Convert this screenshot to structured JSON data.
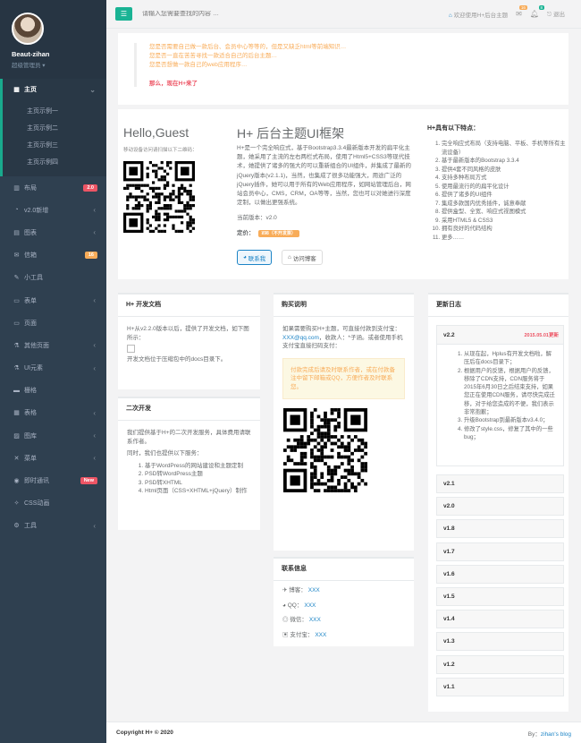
{
  "sidebar": {
    "user": "Beaut-zihan",
    "role": "超级管理员",
    "menu": [
      {
        "icon": "home",
        "label": "主页",
        "active": true
      },
      {
        "icon": "layout",
        "label": "布局",
        "badge": "2.0",
        "badge_color": "#ed5565"
      },
      {
        "icon": "pie",
        "label": "v2.0新增"
      },
      {
        "icon": "chart",
        "label": "图表"
      },
      {
        "icon": "mail",
        "label": "信箱",
        "badge": "16",
        "badge_color": "#f8ac59"
      },
      {
        "icon": "edit",
        "label": "小工具"
      },
      {
        "icon": "form",
        "label": "表单"
      },
      {
        "icon": "desktop",
        "label": "页面"
      },
      {
        "icon": "flask",
        "label": "其他页面"
      },
      {
        "icon": "flask",
        "label": "UI元素"
      },
      {
        "icon": "laptop",
        "label": "栅格"
      },
      {
        "icon": "table",
        "label": "表格"
      },
      {
        "icon": "picture",
        "label": "图库"
      },
      {
        "icon": "cutlery",
        "label": "菜单"
      },
      {
        "icon": "comments",
        "label": "即时通讯",
        "badge": "New",
        "badge_color": "#ed5565"
      },
      {
        "icon": "magic",
        "label": "CSS动画"
      },
      {
        "icon": "tools",
        "label": "工具"
      }
    ],
    "submenu": [
      "主页示例一",
      "主页示例二",
      "主页示例三",
      "主页示例四"
    ]
  },
  "topbar": {
    "search_placeholder": "请输入您需要查找的内容 …",
    "welcome": "欢迎使用H+后台主题",
    "mail_count": "16",
    "bell_count": "8",
    "logout": "退出"
  },
  "notice": {
    "lines": [
      "您是否需要自己做一款后台、会员中心等等的，但是又缺乏html等前端知识…",
      "您是否一直在苦苦寻找一款适合自己的后台主题…",
      "您是否想做一款自己的web应用程序…"
    ],
    "emph": "那么，现在H+来了"
  },
  "intro": {
    "hello": "Hello,Guest",
    "scan": "移动设备访问请扫描以下二维码：",
    "title": "H+ 后台主题UI框架",
    "desc": "H+是一个完全响应式，基于Bootstrap3.3.4最新版本开发的扁平化主题，她采用了主流的左右两栏式布局，使用了Html5+CSS3等现代技术，她提供了诸多的强大的可以重新组合的UI组件，并集成了最新的jQuery版本(v2.1.1)，当然，也集成了很多功能强大，用途广泛的jQuery插件，她可以用于所有的Web应用程序，如网站管理后台，网站会员中心，CMS，CRM，OA等等，当然，您也可以对她进行深度定制，以做出更强系统。",
    "version": "当前版本：v2.0",
    "price_label": "定价：",
    "price_tag": "¥98（不开发票）",
    "btn_contact": "联系我",
    "btn_visit": "访问博客"
  },
  "features": {
    "title": "H+具有以下特点：",
    "items": [
      "完全响应式布局（支持电脑、平板、手机等所有主流设备）",
      "基于最新版本的Bootstrap 3.3.4",
      "提供4套不同风格的皮肤",
      "支持多种布局方式",
      "使用最流行的的扁平化设计",
      "提供了诸多的UI组件",
      "集成多款国内优秀插件，诚意奉献",
      "提供盒型、全宽、响应式视图模式",
      "采用HTML5 & CSS3",
      "拥有良好的代码结构",
      "更多……"
    ]
  },
  "docs": {
    "title": "H+ 开发文档",
    "text": "H+从v2.2.0版本以后，提供了开发文档，如下图所示：",
    "text2": "开发文档位于压缩包中的docs目录下。"
  },
  "dev2": {
    "title": "二次开发",
    "p1": "我们提供基于H+的二次开发服务，具体费用请联系作者。",
    "p2": "同时，我们也提供以下服务：",
    "items": [
      "基于WordPress的网站建设和主题定制",
      "PSD转WordPress主题",
      "PSD转XHTML",
      "Html页面（CSS+XHTML+jQuery）制作"
    ]
  },
  "buy": {
    "title": "购买说明",
    "p1a": "如果需要购买H+主题，可直接付款到支付宝：",
    "email": "XXX@qq.com",
    "p1b": "，收款人：*子涵。或者使用手机支付宝直接扫码支付：",
    "alert": "付款完成后请及时联系作者，或在付款备注中留下邮箱或QQ，方便作者及时联系您。"
  },
  "contact": {
    "title": "联系信息",
    "rows": [
      {
        "icon": "blog",
        "label": "博客：",
        "value": "XXX"
      },
      {
        "icon": "qq",
        "label": "QQ：",
        "value": "XXX"
      },
      {
        "icon": "wechat",
        "label": "微信：",
        "value": "XXX"
      },
      {
        "icon": "alipay",
        "label": "支付宝：",
        "value": "XXX"
      }
    ]
  },
  "changelog": {
    "title": "更新日志",
    "open_version": "v2.2",
    "open_date": "2015.05.01更新",
    "open_items": [
      "从现在起，Hplus有开发文档啦，解压后在docs目录下；",
      "根据用户的反馈，根据用户的反馈，移除了CDN支持，CDN服务将于2015年6月30日之后结束支持，如果您正在使用CDN服务，请尽快完成迁移，对于给您造成的不便，我们表示非常抱歉；",
      "升级Bootstrap到最新版本v3.4.0；",
      "修改了style.css，修复了其中的一些bug；"
    ],
    "versions": [
      "v2.1",
      "v2.0",
      "v1.8",
      "v1.7",
      "v1.6",
      "v1.5",
      "v1.4",
      "v1.3",
      "v1.2",
      "v1.1"
    ]
  },
  "footer": {
    "left": "Copyright H+ © 2020",
    "right_prefix": "By：",
    "right_link": "zihan's blog"
  }
}
